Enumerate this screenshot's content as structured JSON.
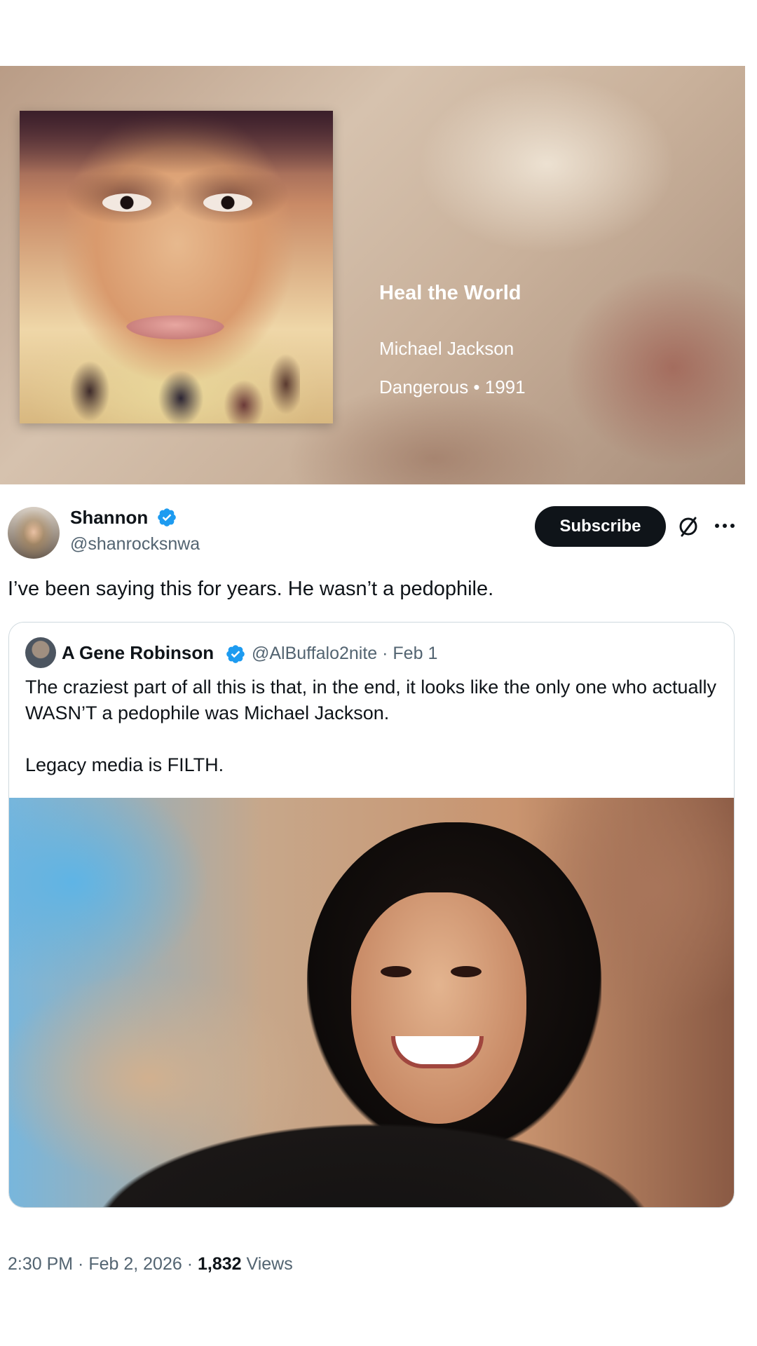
{
  "music_card": {
    "title": "Heal the World",
    "artist": "Michael Jackson",
    "album_year": "Dangerous • 1991"
  },
  "tweet": {
    "display_name": "Shannon",
    "handle": "@shanrocksnwa",
    "subscribe_label": "Subscribe",
    "text": "I’ve been saying this for years. He wasn’t a pedophile.",
    "time": "2:30 PM · Feb 2, 2026 · ",
    "views_count": "1,832",
    "views_label": " Views"
  },
  "quoted_tweet": {
    "display_name": "A Gene Robinson",
    "handle_date": "@AlBuffalo2nite · Feb 1",
    "body_line1": "The craziest part of all this is that, in the end, it looks like the only one who actually WASN’T a pedophile was Michael Jackson.",
    "body_line2": "Legacy media is FILTH."
  },
  "colors": {
    "verified": "#1d9bf0",
    "subscribe_bg": "#0f1419",
    "secondary_text": "#536471"
  },
  "icons": [
    "verified-badge-icon",
    "grok-icon",
    "more-icon"
  ]
}
